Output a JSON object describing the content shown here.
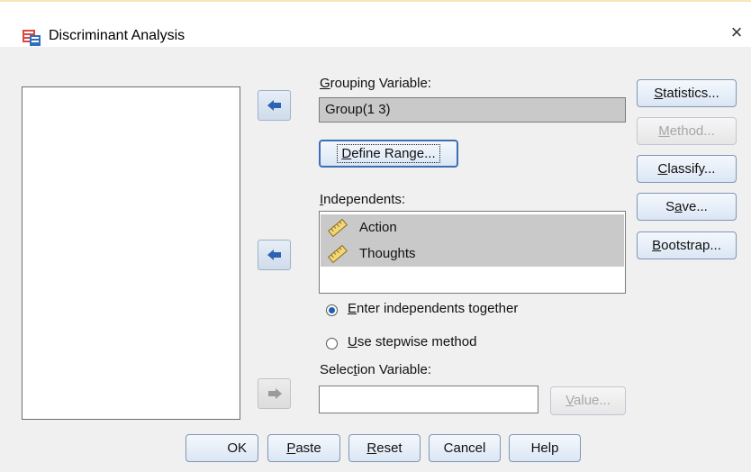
{
  "window": {
    "title": "Discriminant Analysis",
    "close_glyph": "×"
  },
  "grouping": {
    "label_underlined": "G",
    "label_rest": "rouping Variable:",
    "value": "Group(1 3)"
  },
  "define_range": {
    "label_underlined": "D",
    "label_rest": "efine Range..."
  },
  "independents": {
    "label_underlined": "I",
    "label_rest": "ndependents:",
    "items": [
      "Action",
      "Thoughts"
    ]
  },
  "radios": {
    "enter": {
      "label_underlined": "E",
      "label_rest": "nter independents together",
      "checked": true
    },
    "stepwise": {
      "label_underlined": "U",
      "label_rest": "se stepwise method",
      "checked": false
    }
  },
  "selection": {
    "label_pre": "Selec",
    "label_underlined": "t",
    "label_rest": "ion Variable:",
    "value": ""
  },
  "value_button": {
    "label_underlined": "V",
    "label_rest": "alue..."
  },
  "side_buttons": {
    "statistics": {
      "u": "S",
      "rest": "tatistics..."
    },
    "method": {
      "u": "M",
      "rest": "ethod..."
    },
    "classify": {
      "u": "C",
      "rest": "lassify..."
    },
    "save": {
      "pre": "S",
      "u": "a",
      "rest": "ve..."
    },
    "bootstrap": {
      "u": "B",
      "rest": "ootstrap..."
    }
  },
  "bottom_buttons": {
    "ok": "OK",
    "paste": {
      "u": "P",
      "rest": "aste"
    },
    "reset": {
      "u": "R",
      "rest": "eset"
    },
    "cancel": "Cancel",
    "help": "Help"
  },
  "colors": {
    "accent": "#1c5fb5",
    "selected_bg": "#c9c9c9",
    "dialog_bg": "#f0f0f0"
  },
  "icons": [
    "spss-dialog-icon",
    "close-icon",
    "arrow-left-icon",
    "arrow-right-icon",
    "ruler-scale-icon"
  ]
}
